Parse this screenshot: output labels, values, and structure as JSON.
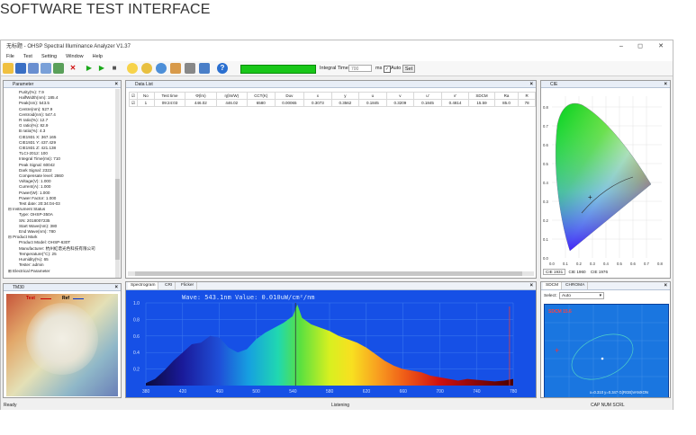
{
  "caption": "SOFTWARE TEST INTERFACE",
  "window": {
    "title": "无标题 - OHSP Spectral Illuminance Analyzer V1.37",
    "min": "–",
    "max": "◻",
    "close": "✕"
  },
  "menu": [
    "File",
    "Test",
    "Setting",
    "Window",
    "Help"
  ],
  "toolbar": {
    "integral_label": "Integral Time",
    "integral_value": "700",
    "unit": "ms",
    "auto_label": "Auto",
    "set_label": "Set"
  },
  "parameter_panel": {
    "title": "Parameter",
    "rows": [
      {
        "t": "Purity(%): 7.9",
        "k": "c"
      },
      {
        "t": "HalfWidth(nm): 185.4",
        "k": "c"
      },
      {
        "t": "Peak(nm): 543.5",
        "k": "c"
      },
      {
        "t": "Centre(nm): 527.9",
        "k": "c"
      },
      {
        "t": "Centroid(nm): 547.4",
        "k": "c"
      },
      {
        "t": "R ratio(%): 12.7",
        "k": "c"
      },
      {
        "t": "G ratio(%): 82.9",
        "k": "c"
      },
      {
        "t": "B ratio(%): 4.3",
        "k": "c"
      },
      {
        "t": "CIE1931 X: 367.165",
        "k": "c"
      },
      {
        "t": "CIE1931 Y: 437.429",
        "k": "c"
      },
      {
        "t": "CIE1931 Z: 421.138",
        "k": "c"
      },
      {
        "t": "TLCI-2012: 100",
        "k": "c"
      },
      {
        "t": "Integral Time(ms): 710",
        "k": "c"
      },
      {
        "t": "Peak Signal: 60042",
        "k": "c"
      },
      {
        "t": "Dark Signal: 2322",
        "k": "c"
      },
      {
        "t": "Compensate level: 2860",
        "k": "c"
      },
      {
        "t": "Voltage(V): 1.000",
        "k": "c"
      },
      {
        "t": "Current(A): 1.000",
        "k": "c"
      },
      {
        "t": "Power(W): 1.000",
        "k": "c"
      },
      {
        "t": "Power Factor: 1.000",
        "k": "c"
      },
      {
        "t": "Test date: 20:34:04-03",
        "k": "c"
      },
      {
        "t": "⊟ Instrument Status",
        "k": "g"
      },
      {
        "t": "Type: OHSP-350A",
        "k": "c"
      },
      {
        "t": "SN: 2018007235",
        "k": "c"
      },
      {
        "t": "Start Wave(nm): 380",
        "k": "c"
      },
      {
        "t": "End Wave(nm): 780",
        "k": "c"
      },
      {
        "t": "⊟ Product Mark",
        "k": "g"
      },
      {
        "t": "Product Model: OHSP-630T",
        "k": "c"
      },
      {
        "t": "Manufacturer: 杭州虹谱光色科技有限公司",
        "k": "c"
      },
      {
        "t": "Temperature(°C): 25",
        "k": "c"
      },
      {
        "t": "Humidity(%): 65",
        "k": "c"
      },
      {
        "t": "Tester: admin",
        "k": "c"
      },
      {
        "t": "⊞ Electrical Parameter",
        "k": "g"
      }
    ]
  },
  "data_list": {
    "title": "Data List",
    "headers": [
      "No",
      "Test time",
      "Φ(lm)",
      "η(lm/W)",
      "CCT(K)",
      "Duv",
      "x",
      "y",
      "u",
      "v",
      "u'",
      "v'",
      "SDCM",
      "Ra",
      "R"
    ],
    "row": [
      "1",
      "09:24:03",
      "446.02",
      "446.02",
      "6580",
      "0.00065",
      "0.3073",
      "0.3562",
      "0.1845",
      "0.3209",
      "0.1845",
      "0.4814",
      "15.59",
      "85.0",
      "78"
    ]
  },
  "cie_panel": {
    "title": "CIE",
    "tabs": [
      "CIE 1931",
      "CIE 1960",
      "CIE 1976"
    ],
    "ticks_y": [
      "0.8",
      "0.7",
      "0.6",
      "0.5",
      "0.4",
      "0.3",
      "0.2",
      "0.1",
      "0.0"
    ],
    "ticks_x": [
      "0.0",
      "0.1",
      "0.2",
      "0.3",
      "0.4",
      "0.5",
      "0.6",
      "0.7",
      "0.8"
    ]
  },
  "spectrogram": {
    "tabs": [
      "Spectrogram",
      "CRI",
      "Flicker"
    ],
    "info": "Wave: 543.1nm Value: 0.010uW/cm²/nm",
    "y_ticks": [
      "1.0",
      "0.8",
      "0.6",
      "0.4",
      "0.2"
    ],
    "x_ticks": [
      "380",
      "420",
      "460",
      "500",
      "540",
      "580",
      "620",
      "660",
      "700",
      "740",
      "780"
    ]
  },
  "chart_data": {
    "type": "area",
    "title": "",
    "xlabel": "",
    "ylabel": "",
    "xlim": [
      380,
      780
    ],
    "ylim": [
      0,
      1.0
    ],
    "x": [
      380,
      390,
      400,
      410,
      420,
      430,
      440,
      450,
      460,
      470,
      480,
      490,
      500,
      510,
      520,
      530,
      540,
      545,
      550,
      560,
      570,
      580,
      590,
      600,
      610,
      620,
      630,
      640,
      650,
      660,
      670,
      680,
      690,
      700,
      710,
      720,
      730,
      740,
      750,
      760,
      770,
      780
    ],
    "values": [
      0.03,
      0.08,
      0.18,
      0.3,
      0.4,
      0.5,
      0.52,
      0.6,
      0.58,
      0.46,
      0.4,
      0.44,
      0.56,
      0.64,
      0.7,
      0.76,
      0.84,
      0.98,
      0.82,
      0.74,
      0.7,
      0.66,
      0.6,
      0.56,
      0.52,
      0.46,
      0.38,
      0.3,
      0.24,
      0.2,
      0.18,
      0.16,
      0.12,
      0.1,
      0.08,
      0.06,
      0.08,
      0.07,
      0.06,
      0.05,
      0.06,
      0.08
    ]
  },
  "tm30": {
    "title": "TM30",
    "legend_test": "Test",
    "legend_ref": "Ref"
  },
  "sdcm_panel": {
    "tabs": [
      "SDCM",
      "CHROMA"
    ],
    "select_label": "Select:",
    "select_value": "Auto",
    "sdcm_title": "SDCM 15.6",
    "coords": "x=0.310 y=0.347 G(RGB)VANXON"
  },
  "status": {
    "left": "Ready",
    "center": "Listening",
    "right": "CAP  NUM  SCRL"
  }
}
